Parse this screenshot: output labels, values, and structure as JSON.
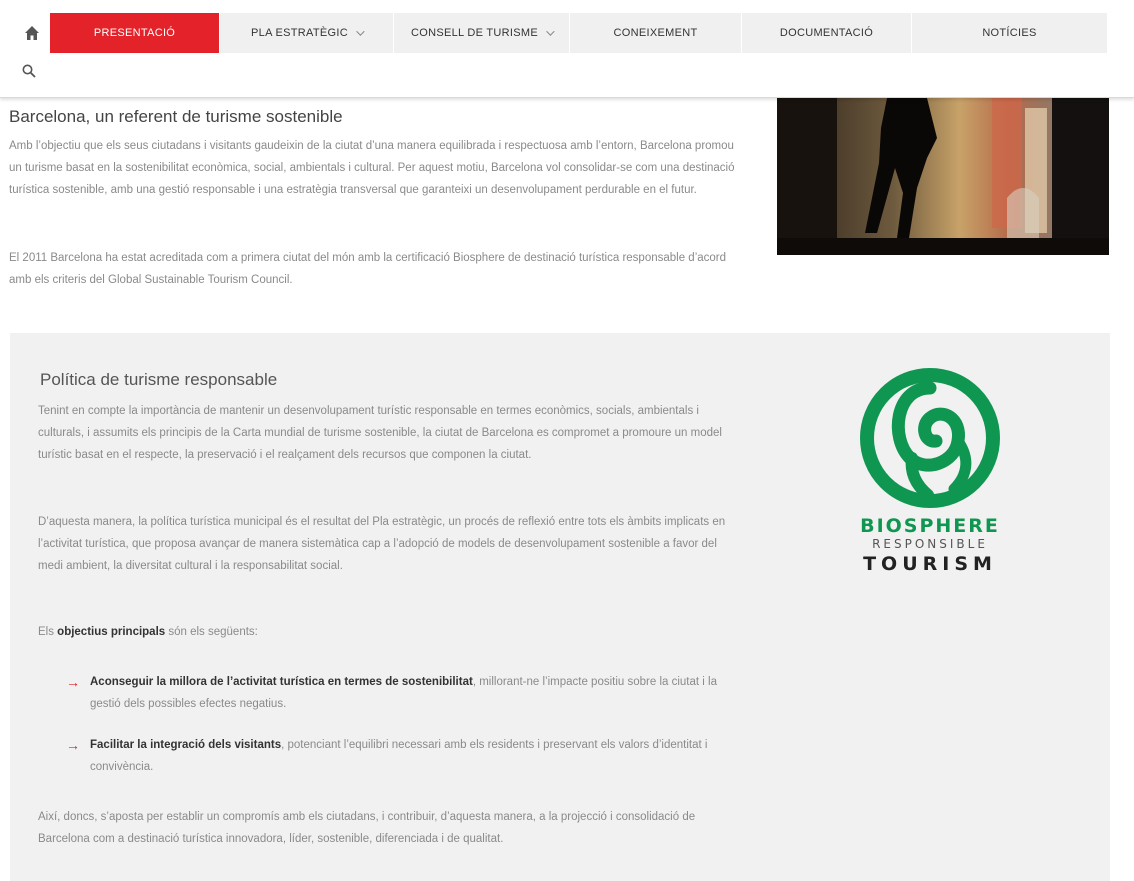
{
  "nav": {
    "items": [
      {
        "label": "PRESENTACIÓ",
        "active": true,
        "dropdown": false
      },
      {
        "label": "PLA ESTRATÈGIC",
        "active": false,
        "dropdown": true
      },
      {
        "label": "CONSELL DE TURISME",
        "active": false,
        "dropdown": true
      },
      {
        "label": "CONEIXEMENT",
        "active": false,
        "dropdown": false
      },
      {
        "label": "DOCUMENTACIÓ",
        "active": false,
        "dropdown": false
      },
      {
        "label": "NOTÍCIES",
        "active": false,
        "dropdown": false
      }
    ],
    "home_icon": "home-icon",
    "search_icon": "search-icon"
  },
  "hero": {
    "title": "Barcelona, un referent de turisme sostenible",
    "p1": "Amb l’objectiu que els seus ciutadans i visitants gaudeixin de la ciutat d’una manera equilibrada i respectuosa amb l’entorn, Barcelona promou un turisme basat en la sostenibilitat econòmica, social, ambientals i cultural. Per aquest motiu, Barcelona vol consolidar-se com una destinació turística sostenible, amb una gestió responsable i una estratègia transversal que garanteixi un desenvolupament perdurable en el futur.",
    "p2": "El 2011 Barcelona ha estat acreditada com a primera ciutat del món amb la certificació Biosphere de destinació turística responsable d’acord amb els criteris del Global Sustainable Tourism Council."
  },
  "panel": {
    "title": "Política de turisme responsable",
    "p1": "Tenint en compte la importància de mantenir un desenvolupament turístic responsable en termes econòmics, socials, ambientals i culturals, i assumits els principis de la Carta mundial de turisme sostenible, la ciutat de Barcelona es compromet a promoure un model turístic basat en el respecte, la preservació i el realçament dels recursos que componen la ciutat.",
    "p2": "D’aquesta manera, la política turística municipal és el resultat del Pla estratègic, un procés de reflexió entre tots els àmbits implicats en l’activitat turística, que proposa avançar de manera sistemàtica cap a l’adopció de models de desenvolupament sostenible a favor del medi ambient, la diversitat cultural i la responsabilitat social.",
    "objectives_pre": "Els ",
    "objectives_bold": "objectius principals",
    "objectives_post": " són els següents:",
    "bullets": [
      {
        "bold": "Aconseguir la millora de l’activitat turística en termes de sostenibilitat",
        "rest": ", millorant-ne l’impacte positiu sobre la ciutat i la gestió dels possibles efectes negatius."
      },
      {
        "bold": "Facilitar la integració dels visitants",
        "rest": ", potenciant l’equilibri necessari amb els residents i preservant els valors d’identitat i convivència."
      }
    ],
    "p3": "Així, doncs, s’aposta per establir un compromís amb els ciutadans, i contribuir, d’aquesta manera, a la projecció i consolidació de Barcelona com a destinació turística innovadora, líder, sostenible, diferenciada i de qualitat."
  },
  "logo": {
    "line1": "BIOSPHERE",
    "line2": "RESPONSIBLE",
    "line3": "TOURISM",
    "color": "#0f9650"
  },
  "colors": {
    "accent": "#e3222a",
    "panel": "#f1f1f1"
  }
}
